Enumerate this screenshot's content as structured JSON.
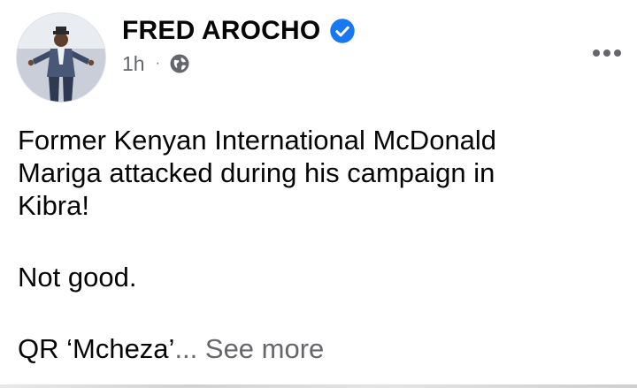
{
  "post": {
    "author_name": "FRED AROCHO",
    "verified_icon": "verified-badge-icon",
    "timestamp": "1h",
    "separator": "·",
    "audience_icon": "globe-icon",
    "more_icon": "more-options-icon",
    "body_line1": "Former Kenyan  International McDonald\nMariga attacked during his campaign in\nKibra!",
    "body_line2": "Not good.",
    "body_line3_prefix": "QR ‘Mcheza’",
    "body_ellipsis_see_more": "... See more"
  },
  "colors": {
    "verified_blue": "#1877f2",
    "secondary_text": "#65676b",
    "primary_text": "#050505"
  }
}
